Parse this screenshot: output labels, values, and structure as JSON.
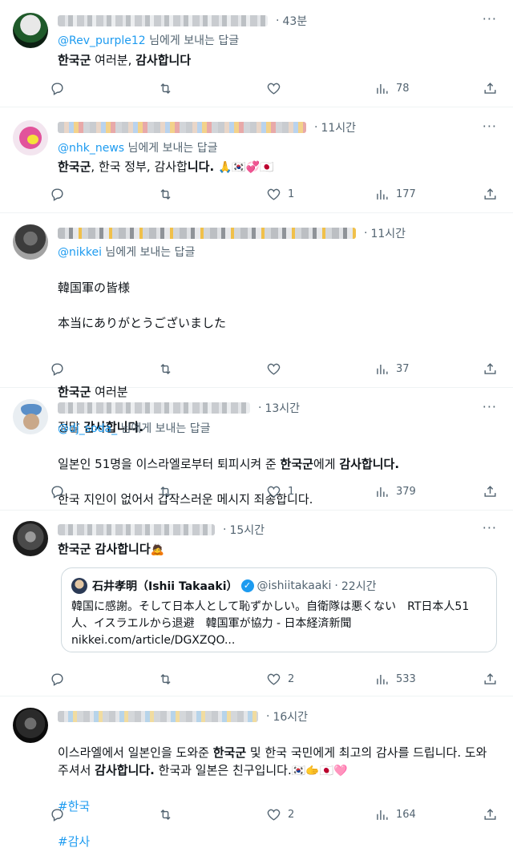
{
  "tweets": [
    {
      "time": "43분",
      "reply_to": "@Rev_purple12",
      "reply_suffix": " 님에게 보내는 답글",
      "body_plain_1": "",
      "bold_1": "한국군",
      "plain_1": " 여러분, ",
      "bold_2": "감사합니다",
      "stats": {
        "reply": "",
        "retweet": "",
        "like": "",
        "views": "78"
      }
    },
    {
      "time": "11시간",
      "reply_to": "@nhk_news",
      "reply_suffix": " 님에게 보내는 답글",
      "bold_1": "한국군",
      "plain_1": ", 한국 정부, 감사합",
      "bold_2": "니다.",
      "emojis": "🙏🇰🇷💞🇯🇵",
      "stats": {
        "reply": "",
        "retweet": "",
        "like": "1",
        "views": "177"
      }
    },
    {
      "time": "11시간",
      "reply_to": "@nikkei",
      "reply_suffix": " 님에게 보내는 답글",
      "line_1": "韓国軍の皆様",
      "line_2": "本当にありがとうございました",
      "bold_1": "한국군",
      "plain_1": " 여러분",
      "plain_2": "정말 ",
      "bold_2": "감사합니다.",
      "stats": {
        "reply": "",
        "retweet": "",
        "like": "",
        "views": "37"
      }
    },
    {
      "time": "13시간",
      "reply_to": "@dj_soda_",
      "reply_suffix": " 님에게 보내는 답글",
      "plain_1": "일본인 51명을 이스라엘로부터 퇴피시켜 준 ",
      "bold_1": "한국군",
      "plain_2": "에게 ",
      "bold_2": "감사합니다.",
      "line_2": "한국 지인이 없어서 갑작스러운 메시지 죄송합니다.",
      "stats": {
        "reply": "",
        "retweet": "",
        "like": "1",
        "views": "379"
      }
    },
    {
      "time": "15시간",
      "bold_1": "한국군 감사합니다",
      "emoji": "🙇",
      "quote": {
        "name": "石井孝明（Ishii Takaaki）",
        "handle": "@ishiitakaaki",
        "time": "22시간",
        "text": "韓国に感謝。そして日本人として恥ずかしい。自衛隊は悪くない　RT日本人51人、イスラエルから退避　韓国軍が協力 - 日本経済新聞",
        "link": "nikkei.com/article/DGXZQO..."
      },
      "stats": {
        "reply": "",
        "retweet": "",
        "like": "2",
        "views": "533"
      }
    },
    {
      "time": "16시간",
      "plain_1": "이스라엘에서 일본인을 도와준 ",
      "bold_1": "한국군",
      "plain_2": " 및 한국 국민에게 최고의 감사를 드립니다. 도와 주셔서 ",
      "bold_2": "감사합니다.",
      "plain_3": " 한국과 일본은 친구입니다.",
      "emojis": "🇰🇷🫱🇯🇵🩷",
      "hashtag_1": "#한국",
      "hashtag_2": "#감사",
      "stats": {
        "reply": "",
        "retweet": "",
        "like": "2",
        "views": "164"
      }
    }
  ],
  "icons": {
    "more": "more-dots-icon",
    "reply": "reply-icon",
    "retweet": "retweet-icon",
    "like": "heart-icon",
    "views": "views-chart-icon",
    "share": "share-icon"
  },
  "colors": {
    "link": "#1d9bf0",
    "secondary": "#536471",
    "text": "#0f1419"
  }
}
